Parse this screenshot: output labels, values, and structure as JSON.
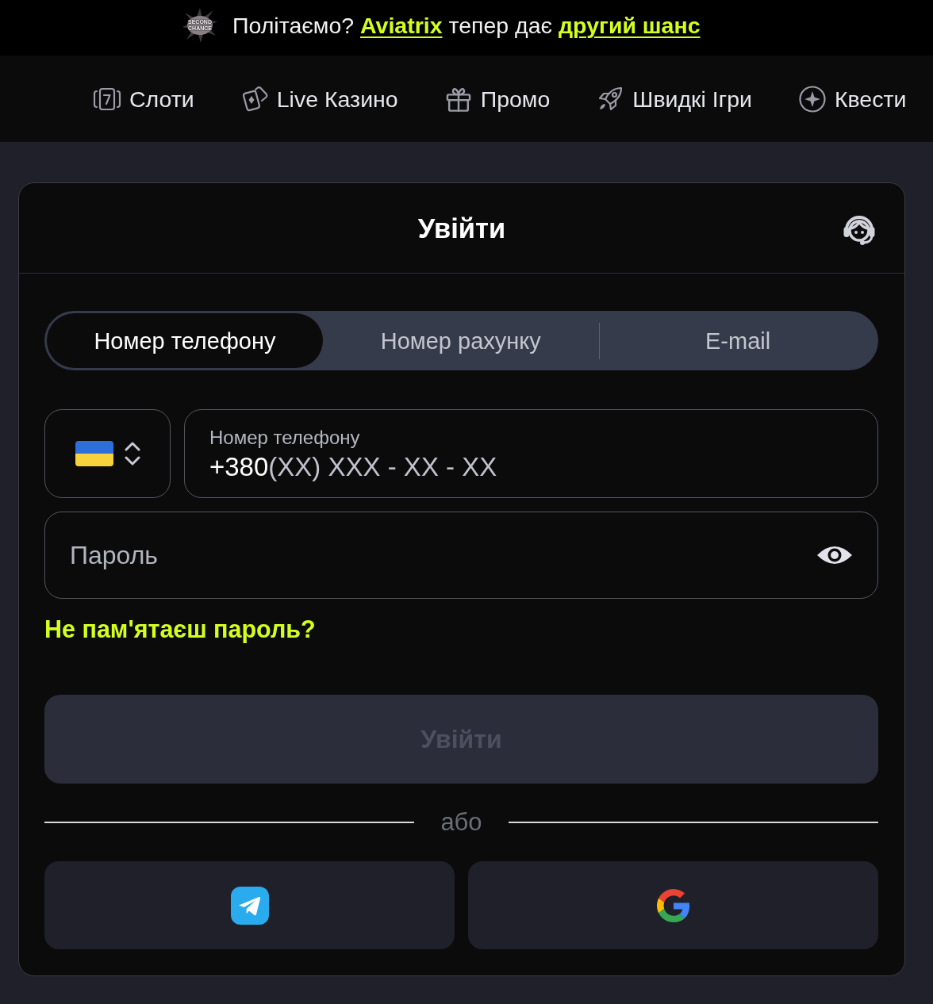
{
  "banner": {
    "badge": [
      "SECOND",
      "CHANCE"
    ],
    "message": [
      {
        "kind": "plain",
        "text": "Політаємо?"
      },
      {
        "kind": "link",
        "text": "Aviatrix"
      },
      {
        "kind": "plain",
        "text": "тепер дає"
      },
      {
        "kind": "link",
        "text": "другий шанс"
      }
    ]
  },
  "nav": [
    {
      "label": "Слоти"
    },
    {
      "label": "Live Казино"
    },
    {
      "label": "Промо"
    },
    {
      "label": "Швидкі Ігри"
    },
    {
      "label": "Квести"
    }
  ],
  "login": {
    "title": "Увійти",
    "tabs": [
      {
        "label": "Номер телефону",
        "selected": true
      },
      {
        "label": "Номер рахунку",
        "selected": false
      },
      {
        "label": "E-mail",
        "selected": false
      }
    ],
    "phone": {
      "label": "Номер телефону",
      "value": "+380",
      "placeholder": "(XX) XXX - XX - XX"
    },
    "password": {
      "placeholder": "Пароль"
    },
    "forgot_link": "Не пам'ятаєш пароль?",
    "submit": {
      "label": "Увійти",
      "disabled": true
    },
    "separator": "або"
  }
}
